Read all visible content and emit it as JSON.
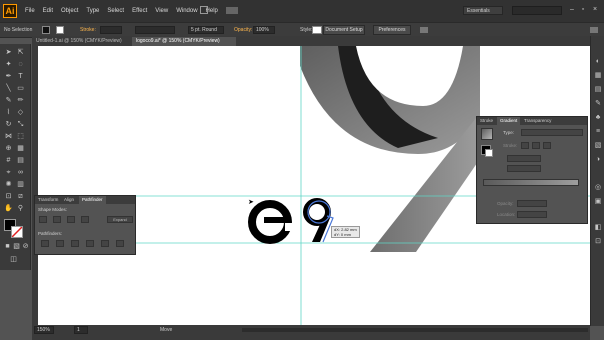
{
  "app": {
    "logo": "Ai"
  },
  "menu": [
    "File",
    "Edit",
    "Object",
    "Type",
    "Select",
    "Effect",
    "View",
    "Window",
    "Help"
  ],
  "workspace": {
    "label": "Essentials"
  },
  "control": {
    "selection": "No Selection",
    "stroke_label": "Stroke:",
    "brush": "5 pt. Round",
    "opacity_label": "Opacity:",
    "opacity_value": "100%",
    "style_label": "Style:",
    "doc_setup": "Document Setup",
    "preferences": "Preferences"
  },
  "tabs": [
    {
      "label": "Untitled-1.ai @ 150% (CMYK/Preview)",
      "active": false
    },
    {
      "label": "logoco9.ai* @ 150% (CMYK/Preview)",
      "active": true
    }
  ],
  "ruler_ticks": [
    "100",
    "150",
    "200",
    "250",
    "300",
    "350",
    "400",
    "450",
    "500",
    "550",
    "600",
    "650",
    "700"
  ],
  "pathfinder": {
    "tabs": [
      "Transform",
      "Align",
      "Pathfinder"
    ],
    "shape_modes": "Shape Modes:",
    "pathfinders": "Pathfinders:",
    "expand": "Expand"
  },
  "gradient_panel": {
    "tabs": [
      "Stroke",
      "Gradient",
      "Transparency"
    ],
    "type_label": "Type:",
    "stroke_label": "Stroke:",
    "opacity_label": "Opacity:",
    "location_label": "Location:"
  },
  "canvas": {
    "tooltip_line1": "dX: 2.82 mm",
    "tooltip_line2": "dY: 0 mm"
  },
  "status": {
    "zoom": "150%",
    "page": "1",
    "tool": "Move"
  },
  "colors": {
    "accent": "#4a78d8",
    "guide": "#5fd6c6",
    "app_bg": "#535353",
    "panel": "#535353"
  }
}
